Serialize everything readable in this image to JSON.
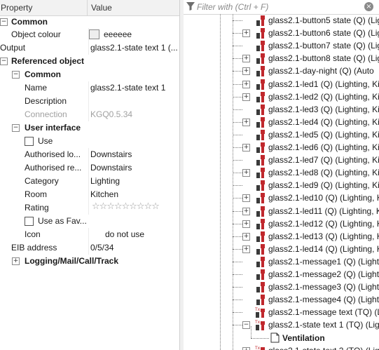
{
  "property_panel": {
    "header": {
      "property": "Property",
      "value": "Value"
    },
    "common_group": "Common",
    "object_colour": {
      "label": "Object colour",
      "value": "eeeeee",
      "color": "#eeeeee"
    },
    "output": {
      "label": "Output",
      "value": "glass2.1-state text 1 (..."
    },
    "referenced_object": "Referenced object",
    "ref_common": "Common",
    "name": {
      "label": "Name",
      "value": "glass2.1-state text 1"
    },
    "description": {
      "label": "Description",
      "value": ""
    },
    "connection": {
      "label": "Connection",
      "value": "KGQ0.5.34"
    },
    "user_interface": "User interface",
    "use": {
      "label": "Use"
    },
    "authorised_lo": {
      "label": "Authorised lo...",
      "value": "Downstairs"
    },
    "authorised_re": {
      "label": "Authorised re...",
      "value": "Downstairs"
    },
    "category": {
      "label": "Category",
      "value": "Lighting"
    },
    "room": {
      "label": "Room",
      "value": "Kitchen"
    },
    "rating": {
      "label": "Rating",
      "stars": "☆☆☆☆☆☆☆☆☆"
    },
    "use_as_fav": {
      "label": "Use as Fav..."
    },
    "icon": {
      "label": "Icon",
      "value": "do not use"
    },
    "eib_address": {
      "label": "EIB address",
      "value": "0/5/34"
    },
    "logging": "Logging/Mail/Call/Track"
  },
  "tree_panel": {
    "filter_placeholder": "Filter with (Ctrl + F)",
    "items": [
      {
        "label": "glass2.1-button5 state (Q) (Lig",
        "expandable": false,
        "icon": "output-q-icon"
      },
      {
        "label": "glass2.1-button6 state (Q) (Lig",
        "expandable": true,
        "icon": "output-q-icon"
      },
      {
        "label": "glass2.1-button7 state (Q) (Lig",
        "expandable": false,
        "icon": "output-q-icon"
      },
      {
        "label": "glass2.1-button8 state (Q) (Lig",
        "expandable": true,
        "icon": "output-q-icon"
      },
      {
        "label": "glass2.1-day-night (Q) (Auto",
        "expandable": true,
        "icon": "output-q-icon"
      },
      {
        "label": "glass2.1-led1 (Q) (Lighting, Ki",
        "expandable": true,
        "icon": "output-q-icon"
      },
      {
        "label": "glass2.1-led2 (Q) (Lighting, Ki",
        "expandable": true,
        "icon": "output-q-icon"
      },
      {
        "label": "glass2.1-led3 (Q) (Lighting, Ki",
        "expandable": false,
        "icon": "output-q-icon"
      },
      {
        "label": "glass2.1-led4 (Q) (Lighting, Ki",
        "expandable": true,
        "icon": "output-q-icon"
      },
      {
        "label": "glass2.1-led5 (Q) (Lighting, Ki",
        "expandable": false,
        "icon": "output-q-icon"
      },
      {
        "label": "glass2.1-led6 (Q) (Lighting, Ki",
        "expandable": true,
        "icon": "output-q-icon"
      },
      {
        "label": "glass2.1-led7 (Q) (Lighting, Ki",
        "expandable": false,
        "icon": "output-q-icon"
      },
      {
        "label": "glass2.1-led8 (Q) (Lighting, Ki",
        "expandable": true,
        "icon": "output-q-icon"
      },
      {
        "label": "glass2.1-led9 (Q) (Lighting, Ki",
        "expandable": false,
        "icon": "output-q-icon"
      },
      {
        "label": "glass2.1-led10 (Q) (Lighting, Ki",
        "expandable": true,
        "icon": "output-q-icon"
      },
      {
        "label": "glass2.1-led11 (Q) (Lighting, K",
        "expandable": true,
        "icon": "output-q-icon"
      },
      {
        "label": "glass2.1-led12 (Q) (Lighting, K",
        "expandable": true,
        "icon": "output-q-icon"
      },
      {
        "label": "glass2.1-led13 (Q) (Lighting, K",
        "expandable": true,
        "icon": "output-q-icon"
      },
      {
        "label": "glass2.1-led14 (Q) (Lighting, K",
        "expandable": true,
        "icon": "output-q-icon"
      },
      {
        "label": "glass2.1-message1 (Q) (Lighti",
        "expandable": false,
        "icon": "output-q-icon"
      },
      {
        "label": "glass2.1-message2 (Q) (Lighti",
        "expandable": false,
        "icon": "output-q-icon"
      },
      {
        "label": "glass2.1-message3 (Q) (Lighti",
        "expandable": false,
        "icon": "output-q-icon"
      },
      {
        "label": "glass2.1-message4 (Q) (Lighti",
        "expandable": false,
        "icon": "output-q-icon"
      },
      {
        "label": "glass2.1-message text (TQ) (L",
        "expandable": false,
        "icon": "output-tq-icon"
      },
      {
        "label": "glass2.1-state text 1 (TQ) (Lig",
        "expandable": true,
        "expanded": true,
        "icon": "output-tq-icon"
      },
      {
        "label": "Ventilation",
        "child": true,
        "icon": "document-icon"
      },
      {
        "label": "glass2.1-state text 2 (TQ) (Lig",
        "expandable": true,
        "icon": "output-tq-icon"
      }
    ]
  },
  "colors": {
    "icon_red": "#c0282d",
    "icon_dark": "#3a3a3a"
  }
}
